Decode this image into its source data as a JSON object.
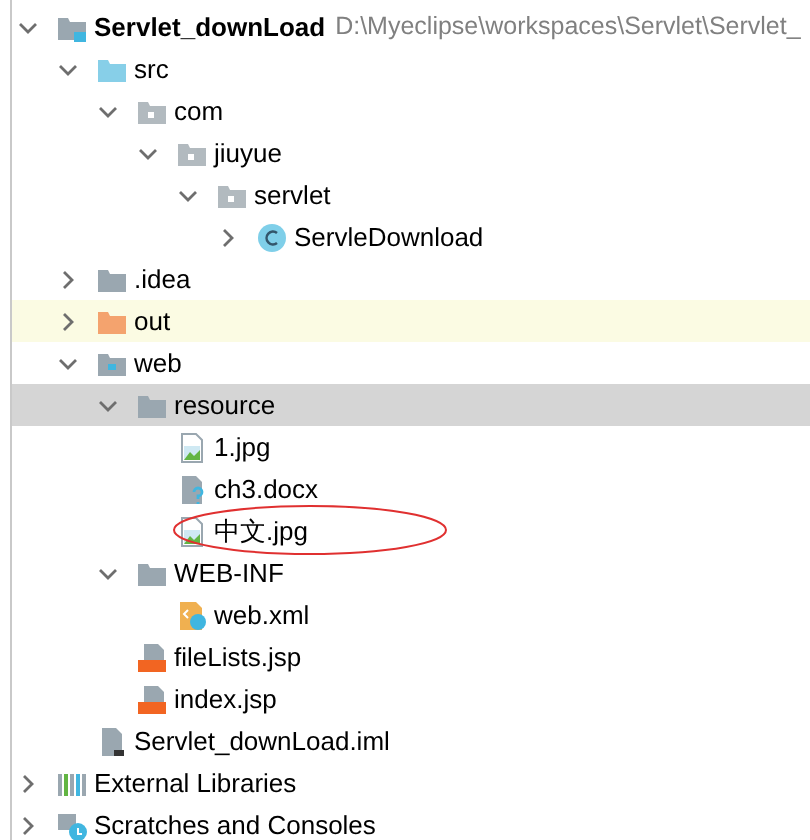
{
  "project_tree": [
    {
      "label": "Servlet_downLoad",
      "kind": "project",
      "bold": true,
      "path": "D:\\Myeclipse\\workspaces\\Servlet\\Servlet_",
      "expanded": true,
      "children": [
        {
          "label": "src",
          "kind": "source-folder",
          "expanded": true,
          "children": [
            {
              "label": "com",
              "kind": "package",
              "expanded": true,
              "children": [
                {
                  "label": "jiuyue",
                  "kind": "package",
                  "expanded": true,
                  "children": [
                    {
                      "label": "servlet",
                      "kind": "package",
                      "expanded": true,
                      "children": [
                        {
                          "label": "ServleDownload",
                          "kind": "class",
                          "expanded": false
                        }
                      ]
                    }
                  ]
                }
              ]
            }
          ]
        },
        {
          "label": ".idea",
          "kind": "folder",
          "expanded": false
        },
        {
          "label": "out",
          "kind": "excluded-folder",
          "expanded": false,
          "highlighted": true
        },
        {
          "label": "web",
          "kind": "web-folder",
          "expanded": true,
          "children": [
            {
              "label": "resource",
              "kind": "folder",
              "expanded": true,
              "selected": true,
              "children": [
                {
                  "label": "1.jpg",
                  "kind": "image-file"
                },
                {
                  "label": "ch3.docx",
                  "kind": "unknown-file"
                },
                {
                  "label": "中文.jpg",
                  "kind": "image-file",
                  "circled": true
                }
              ]
            },
            {
              "label": "WEB-INF",
              "kind": "folder",
              "expanded": true,
              "children": [
                {
                  "label": "web.xml",
                  "kind": "xml-file"
                }
              ]
            },
            {
              "label": "fileLists.jsp",
              "kind": "jsp-file"
            },
            {
              "label": "index.jsp",
              "kind": "jsp-file"
            }
          ]
        },
        {
          "label": "Servlet_downLoad.iml",
          "kind": "module-file"
        }
      ]
    },
    {
      "label": "External Libraries",
      "kind": "libraries",
      "expanded": false
    },
    {
      "label": "Scratches and Consoles",
      "kind": "scratches",
      "expanded": false
    }
  ]
}
